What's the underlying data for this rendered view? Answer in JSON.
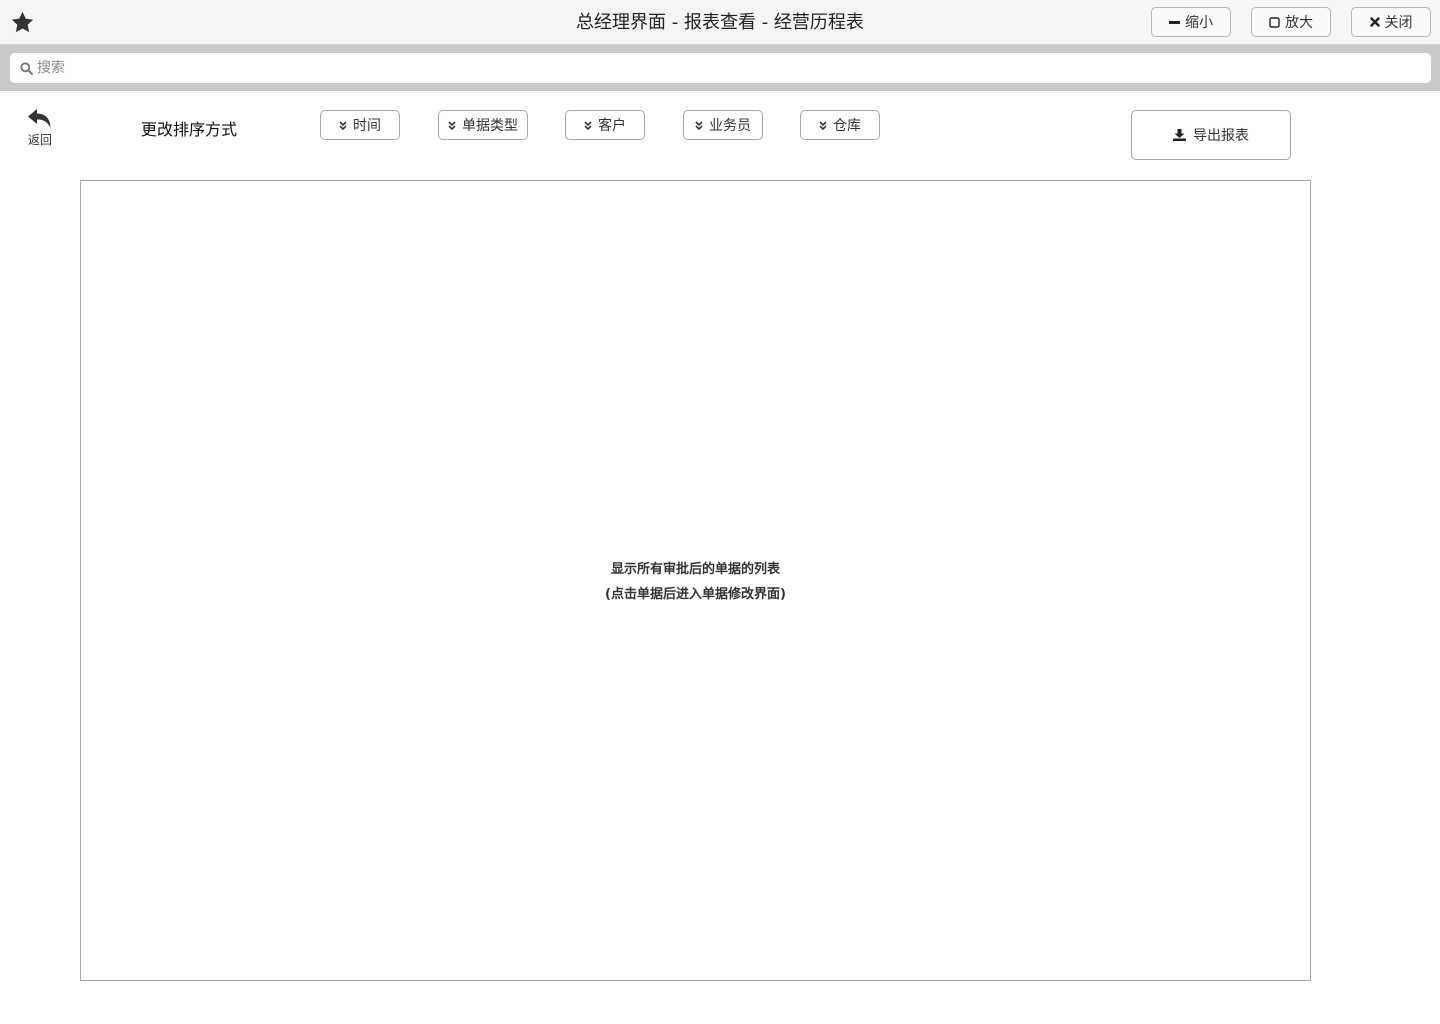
{
  "window": {
    "title": "总经理界面 - 报表查看 - 经营历程表",
    "buttons": {
      "minimize": "缩小",
      "maximize": "放大",
      "close": "关闭"
    }
  },
  "search": {
    "placeholder": "搜索",
    "value": ""
  },
  "toolbar": {
    "back_label": "返回",
    "sort_label": "更改排序方式",
    "sort_options": {
      "time": "时间",
      "doc_type": "单据类型",
      "customer": "客户",
      "salesman": "业务员",
      "warehouse": "仓库"
    },
    "export_label": "导出报表"
  },
  "list": {
    "line1": "显示所有审批后的单据的列表",
    "line2": "(点击单据后进入单据修改界面)"
  },
  "icons": {
    "titlebar": "star-icon",
    "minimize": "minus-icon",
    "maximize": "square-icon",
    "close": "times-icon",
    "search": "search-icon",
    "back": "reply-icon",
    "sort": "double-chevron-down-icon",
    "export": "download-icon"
  }
}
